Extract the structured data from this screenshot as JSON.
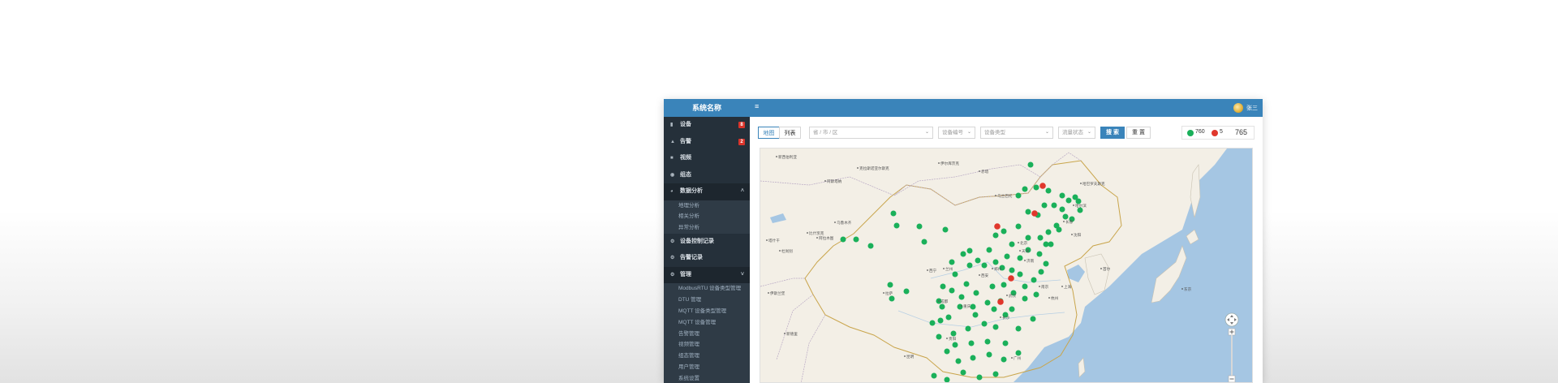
{
  "sidebar": {
    "brand": "系统名称",
    "items": [
      {
        "label": "设备",
        "icon": "device-icon",
        "badge": "8"
      },
      {
        "label": "告警",
        "icon": "alarm-icon",
        "badge": "2"
      },
      {
        "label": "视频",
        "icon": "video-icon"
      },
      {
        "label": "组态",
        "icon": "eye-icon"
      },
      {
        "label": "数据分析",
        "icon": "pie-chart-icon",
        "expanded": true,
        "children": [
          "地理分析",
          "相关分析",
          "异常分析"
        ]
      },
      {
        "label": "设备控制记录",
        "icon": "gear-icon"
      },
      {
        "label": "告警记录",
        "icon": "gear-icon"
      },
      {
        "label": "管理",
        "icon": "gear-icon",
        "expanded": true,
        "children": [
          "ModbusRTU 设备类型管理",
          "DTU 管理",
          "MQTT 设备类型管理",
          "MQTT 设备管理",
          "告警管理",
          "视频管理",
          "组态管理",
          "用户管理",
          "系统设置"
        ]
      }
    ]
  },
  "header": {
    "menu_icon": "hamburger-icon",
    "user_name": "张三",
    "avatar": "user-avatar"
  },
  "toolbar": {
    "tab_map": "地图",
    "tab_list": "列表",
    "region_placeholder": "省 / 市 / 区",
    "device_no_placeholder": "设备编号",
    "device_type_placeholder": "设备类型",
    "status_placeholder": "流量状态",
    "search_label": "搜 索",
    "reset_label": "重 置"
  },
  "status": {
    "online_count": "760",
    "alarm_count": "5",
    "total": "765",
    "online_color": "#1ab05a",
    "alarm_color": "#e0372c"
  },
  "map": {
    "labels": [
      "新西伯利亚",
      "克拉斯诺亚尔斯克",
      "伊尔库茨克",
      "赤塔",
      "哈巴罗夫斯克",
      "乌兰巴托",
      "阿斯塔纳",
      "阿拉木图",
      "乌鲁木齐",
      "北京",
      "沈阳",
      "长春",
      "哈尔滨",
      "天津",
      "济南",
      "郑州",
      "西安",
      "兰州",
      "西宁",
      "成都",
      "重庆",
      "武汉",
      "南京",
      "上海",
      "杭州",
      "长沙",
      "拉萨",
      "昆明",
      "贵阳",
      "广州",
      "首尔",
      "东京",
      "伊斯兰堡",
      "新德里",
      "杜尚别",
      "塔什干",
      "比什凯克"
    ],
    "zoom_icon": "pan-icon"
  }
}
